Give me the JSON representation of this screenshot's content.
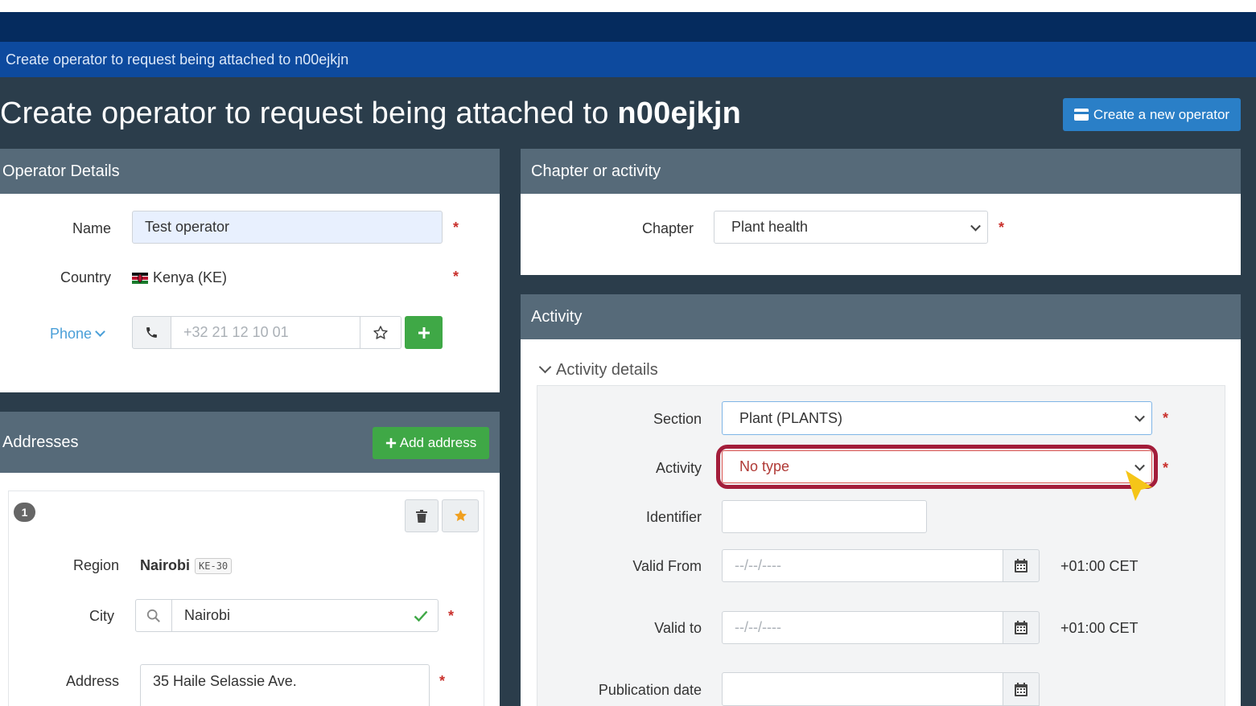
{
  "breadcrumb": "Create operator to request being attached to n00ejkjn",
  "page_title": {
    "text": "Create operator to request being attached to ",
    "bold": "n00ejkjn"
  },
  "create_button": {
    "label": "Create a new operator",
    "icon": "card-icon"
  },
  "operator_details": {
    "title": "Operator Details",
    "name_label": "Name",
    "name_value": "Test operator",
    "country_label": "Country",
    "country_value": "Kenya (KE)",
    "phone_label": "Phone",
    "phone_placeholder": "+32 21 12 10 01",
    "required_mark": "*"
  },
  "addresses": {
    "title": "Addresses",
    "add_button": "Add address",
    "index": "1",
    "region_label": "Region",
    "region_value": "Nairobi",
    "region_code": "KE-30",
    "city_label": "City",
    "city_value": "Nairobi",
    "address_label": "Address",
    "address_value": "35 Haile Selassie Ave."
  },
  "chapter": {
    "title": "Chapter or activity",
    "chapter_label": "Chapter",
    "chapter_value": "Plant health"
  },
  "activity": {
    "title": "Activity",
    "details_toggle": "Activity details",
    "section_label": "Section",
    "section_value": "Plant (PLANTS)",
    "activity_label": "Activity",
    "activity_value": "No type",
    "identifier_label": "Identifier",
    "valid_from_label": "Valid From",
    "valid_to_label": "Valid to",
    "publication_label": "Publication date",
    "date_placeholder": "--/--/----",
    "timezone": "+01:00 CET"
  },
  "colors": {
    "accent": "#2a7fc7",
    "success": "#3fa846",
    "required": "#c9302c",
    "highlight": "#a31d3a",
    "cursor": "#f5c518"
  }
}
